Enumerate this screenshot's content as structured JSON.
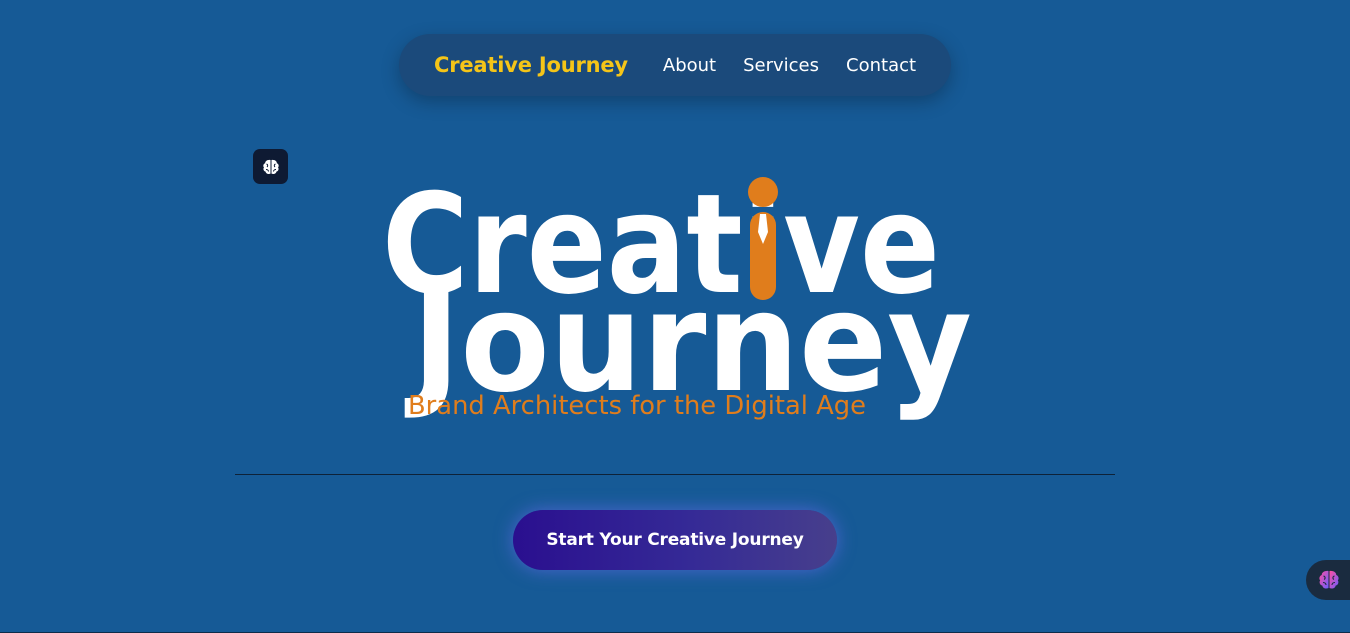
{
  "nav": {
    "brand": "Creative Journey",
    "links": [
      "About",
      "Services",
      "Contact"
    ]
  },
  "logo": {
    "line1": "Creative",
    "line2": "Journey",
    "tagline": "Brand Architects for the Digital Age"
  },
  "cta": {
    "label": "Start Your Creative Journey"
  },
  "colors": {
    "background": "#165a96",
    "brand_yellow": "#f5c518",
    "accent_orange": "#e07d1c",
    "cta_purple": "#2a0f8f"
  },
  "icons": {
    "badge": "brain-icon",
    "floating": "brain-gradient-icon"
  }
}
